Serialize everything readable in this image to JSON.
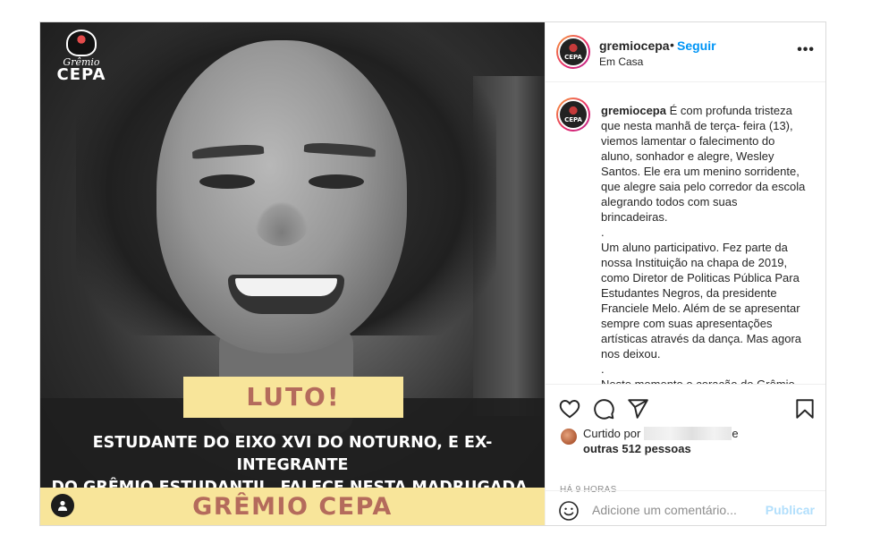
{
  "post": {
    "image": {
      "logo_script": "Grêmio",
      "logo_text": "CEPA",
      "luto": "LUTO!",
      "banner_line1": "ESTUDANTE DO EIXO XVI DO NOTURNO, E EX-INTEGRANTE",
      "banner_line2": "DO GRÊMIO ESTUDANTIL, FALECE NESTA MADRUGADA.",
      "footer_title": "GRÊMIO CEPA"
    },
    "header": {
      "username": "gremiocepa",
      "separator": "•",
      "follow_label": "Seguir",
      "location": "Em Casa",
      "more": "•••"
    },
    "caption": {
      "username": "gremiocepa",
      "paragraph1": " É com profunda tristeza que nesta manhã de terça- feira (13), viemos lamentar o falecimento do aluno, sonhador e alegre, Wesley Santos. Ele era um menino sorridente, que alegre saia pelo corredor da escola alegrando todos com suas brincadeiras.",
      "sep1": ".",
      "paragraph2": "Um aluno participativo. Fez parte da nossa Instituição na chapa de 2019, como Diretor de Politicas Pública Para Estudantes Negros, da presidente Franciele Melo. Além de se apresentar sempre com suas apresentações artísticas através da dança. Mas agora nos deixou.",
      "sep2": ".",
      "paragraph3": "Neste momento o coração do Grêmio"
    },
    "likes": {
      "prefix": "Curtido por",
      "suffix": "e",
      "others": "outras 512 pessoas"
    },
    "time": "HÁ 9 HORAS",
    "comment": {
      "placeholder": "Adicione um comentário...",
      "publish_label": "Publicar"
    },
    "icons": {
      "like": "heart-icon",
      "comment": "comment-icon",
      "share": "send-icon",
      "save": "bookmark-icon",
      "emoji": "emoji-icon",
      "tag": "user-tag-icon"
    },
    "colors": {
      "link": "#0095f6",
      "publish_disabled": "#b2dffc",
      "banner_yellow": "#f8e59a",
      "banner_text": "#b46b5c"
    }
  }
}
